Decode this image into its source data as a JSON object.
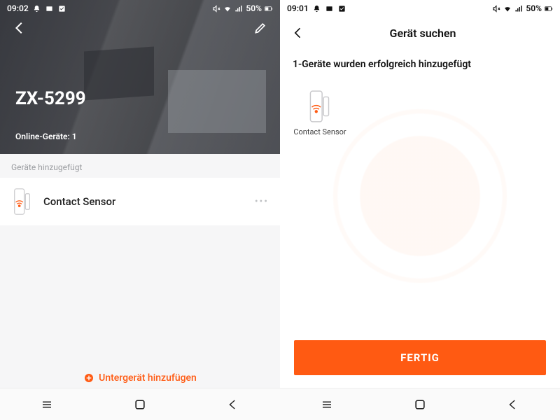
{
  "left": {
    "status": {
      "time": "09:02",
      "notif_icons": [
        "bell",
        "window",
        "dnd"
      ],
      "right_icons": [
        "mute",
        "wifi",
        "signal"
      ],
      "battery": "50%"
    },
    "hero": {
      "title": "ZX-5299",
      "subtitle": "Online-Geräte: 1"
    },
    "section_label": "Geräte hinzugefügt",
    "device": {
      "name": "Contact Sensor",
      "more": "•••"
    },
    "add_sub": "Untergerät hinzufügen"
  },
  "right": {
    "status": {
      "time": "09:01",
      "notif_icons": [
        "bell",
        "window",
        "dnd"
      ],
      "right_icons": [
        "mute",
        "wifi",
        "signal"
      ],
      "battery": "50%"
    },
    "header": "Gerät suchen",
    "success": "1-Geräte wurden erfolgreich hinzugefügt",
    "found": {
      "label": "Contact Sensor"
    },
    "done": "FERTIG"
  },
  "nav_icons": [
    "recents",
    "home",
    "back"
  ]
}
